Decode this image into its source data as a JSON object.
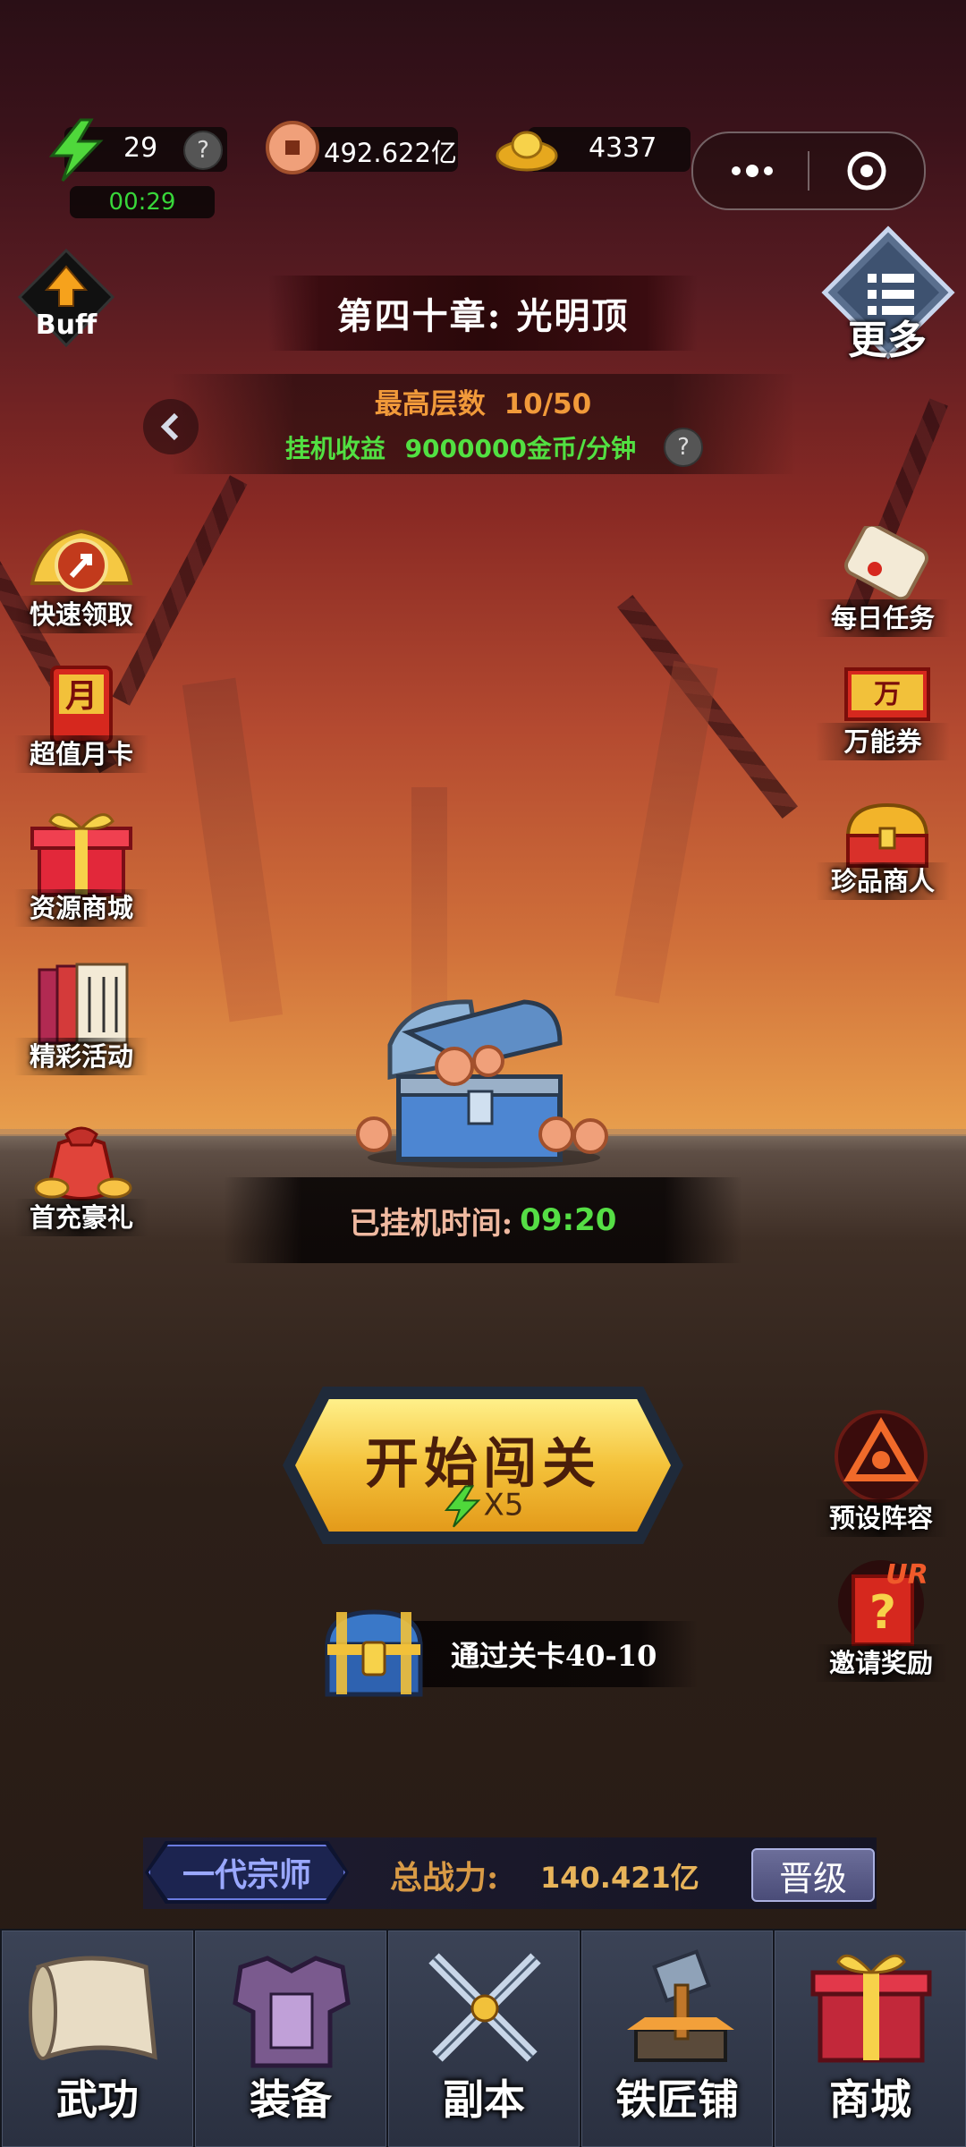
{
  "top_bar": {
    "energy": "29",
    "energy_timer": "00:29",
    "copper": "492.622亿",
    "gold": "4337",
    "help": "?"
  },
  "buff_label": "Buff",
  "more_label": "更多",
  "chapter": {
    "title": "第四十章: 光明顶",
    "floor_label": "最高层数",
    "floor_value": "10/50",
    "idle_income_label": "挂机收益",
    "idle_income_value": "9000000金币/分钟"
  },
  "left_menu": [
    "快速领取",
    "超值月卡",
    "资源商城",
    "精彩活动",
    "首充豪礼"
  ],
  "right_menu": [
    "每日任务",
    "万能券",
    "珍品商人"
  ],
  "right_lower_menu": [
    "预设阵容",
    "邀请奖励"
  ],
  "badge_ur": "UR",
  "badge_month": "月",
  "badge_wan": "万",
  "idle_time": {
    "label": "已挂机时间:",
    "value": "09:20"
  },
  "start_button": {
    "label": "开始闯关",
    "cost": "X5"
  },
  "pass_reward": "通过关卡40-10",
  "power": {
    "rank": "一代宗师",
    "label": "总战力:",
    "value": "140.421亿",
    "upgrade": "晋级"
  },
  "nav_tabs": [
    "武功",
    "装备",
    "副本",
    "铁匠铺",
    "商城"
  ]
}
